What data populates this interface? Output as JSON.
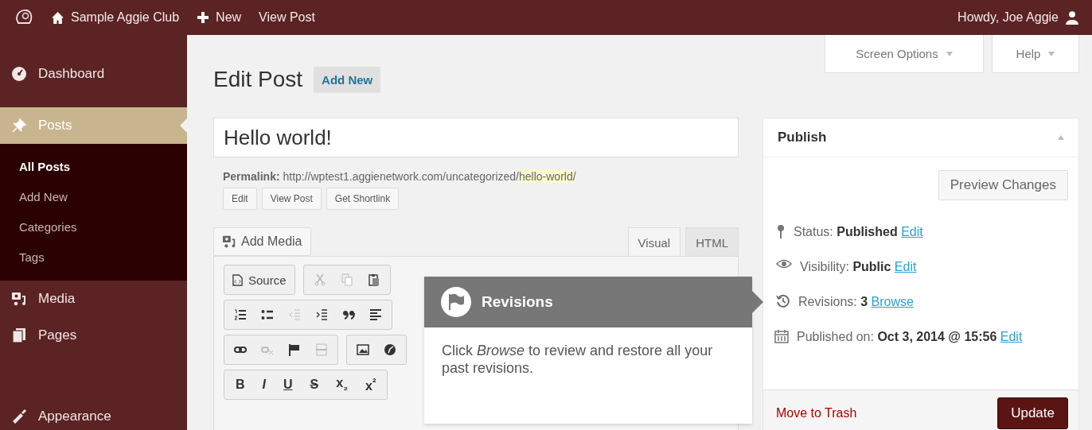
{
  "admin_bar": {
    "site_name": "Sample Aggie Club",
    "new_label": "New",
    "view_post": "View Post",
    "greeting": "Howdy, Joe Aggie"
  },
  "sidebar": {
    "items": [
      {
        "label": "Dashboard",
        "selected": false
      },
      {
        "label": "Posts",
        "selected": true,
        "children": [
          {
            "label": "All Posts",
            "selected": true
          },
          {
            "label": "Add New",
            "selected": false
          },
          {
            "label": "Categories",
            "selected": false
          },
          {
            "label": "Tags",
            "selected": false
          }
        ]
      },
      {
        "label": "Media",
        "selected": false
      },
      {
        "label": "Pages",
        "selected": false
      },
      {
        "label": "Appearance",
        "selected": false
      }
    ]
  },
  "screen_tabs": [
    "Screen Options",
    "Help"
  ],
  "page_title": "Edit Post",
  "add_new": "Add New",
  "title_field": {
    "value": "Hello world!"
  },
  "permalink": {
    "label": "Permalink:",
    "url": "http://wptest1.aggienetwork.com/uncategorized/",
    "slug": "hello-world",
    "suffix": "/"
  },
  "permalink_buttons": [
    "Edit",
    "View Post",
    "Get Shortlink"
  ],
  "add_media": "Add Media",
  "editor_tabs": [
    {
      "label": "Visual",
      "selected": true
    },
    {
      "label": "HTML",
      "selected": false
    }
  ],
  "toolbar": {
    "source_button": "Source",
    "format_buttons": [
      "B",
      "I",
      "U",
      "S",
      "x$_{₂}$",
      "x$^{²}$"
    ]
  },
  "tooltip": {
    "title": "Revisions",
    "text": "Click *Browse* to review and restore all your past revisions."
  },
  "publish": {
    "title": "Publish",
    "preview": "Preview Changes",
    "rows": [
      {
        "label": "Status:",
        "value": "Published",
        "link": "Edit"
      },
      {
        "label": "Visibility:",
        "value": "Public",
        "link": "Edit"
      },
      {
        "label": "Revisions:",
        "value": "3",
        "link": "Browse"
      },
      {
        "label": "Published on:",
        "value": "Oct 3, 2014 @ 15:56",
        "link": "Edit"
      }
    ],
    "trash": "Move to Trash",
    "update": "Update"
  }
}
